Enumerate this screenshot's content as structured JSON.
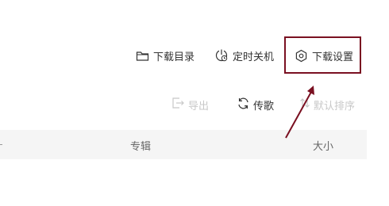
{
  "toolbar": {
    "download_dir_label": "下载目录",
    "timer_shutdown_label": "定时关机",
    "download_settings_label": "下载设置"
  },
  "actions": {
    "export_label": "导出",
    "share_label": "传歌",
    "default_sort_label": "默认排序"
  },
  "table": {
    "columns": [
      "专辑",
      "大小"
    ]
  },
  "colors": {
    "highlight": "#7a1021",
    "disabled_text": "#c8c8c8",
    "header_bg": "#f5f5f5"
  },
  "icons": [
    "folder-icon",
    "timer-power-icon",
    "settings-hexagon-icon",
    "export-icon",
    "sync-icon",
    "sort-icon"
  ]
}
